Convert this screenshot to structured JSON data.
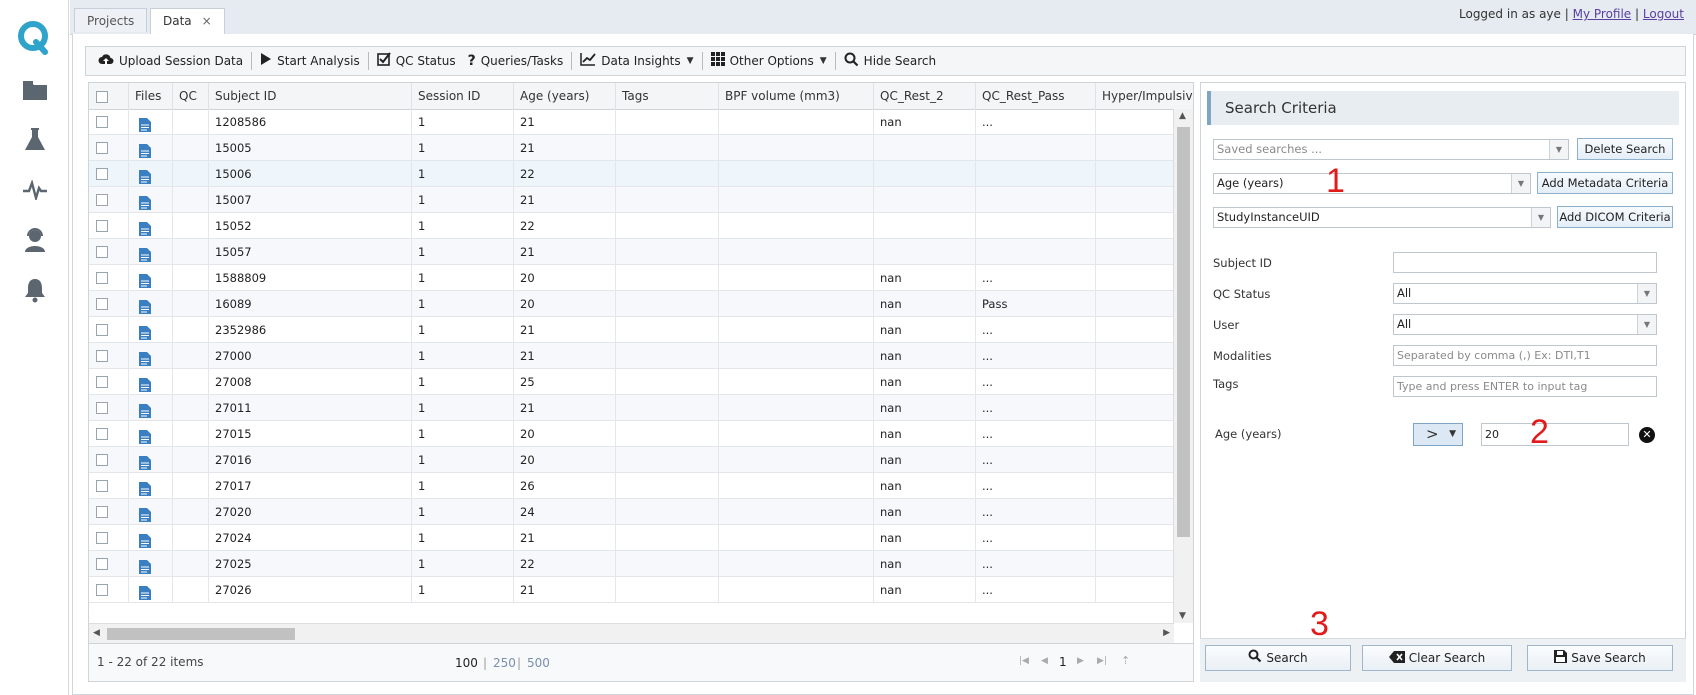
{
  "tabs": [
    {
      "label": "Projects"
    },
    {
      "label": "Data",
      "close": "×"
    }
  ],
  "user": {
    "logged_in_text": "Logged in as",
    "username": "aye",
    "sep": "|",
    "profile_link": "My Profile",
    "logout_link": "Logout"
  },
  "toolbar": {
    "upload": "Upload Session Data",
    "start": "Start Analysis",
    "qc": "QC Status",
    "queries": "Queries/Tasks",
    "insights": "Data Insights",
    "other": "Other Options",
    "hide": "Hide Search"
  },
  "grid": {
    "headers": [
      "Files",
      "QC",
      "Subject ID",
      "Session ID",
      "Age (years)",
      "Tags",
      "BPF volume (mm3)",
      "QC_Rest_2",
      "QC_Rest_Pass",
      "Hyper/Impulsiv"
    ],
    "rows": [
      {
        "subject": "1208586",
        "session": "1",
        "age": "21",
        "qc_rest_2": "nan",
        "qc_rest_pass": "..."
      },
      {
        "subject": "15005",
        "session": "1",
        "age": "21",
        "qc_rest_2": "",
        "qc_rest_pass": ""
      },
      {
        "subject": "15006",
        "session": "1",
        "age": "22",
        "qc_rest_2": "",
        "qc_rest_pass": ""
      },
      {
        "subject": "15007",
        "session": "1",
        "age": "21",
        "qc_rest_2": "",
        "qc_rest_pass": ""
      },
      {
        "subject": "15052",
        "session": "1",
        "age": "22",
        "qc_rest_2": "",
        "qc_rest_pass": ""
      },
      {
        "subject": "15057",
        "session": "1",
        "age": "21",
        "qc_rest_2": "",
        "qc_rest_pass": ""
      },
      {
        "subject": "1588809",
        "session": "1",
        "age": "20",
        "qc_rest_2": "nan",
        "qc_rest_pass": "..."
      },
      {
        "subject": "16089",
        "session": "1",
        "age": "20",
        "qc_rest_2": "nan",
        "qc_rest_pass": "Pass"
      },
      {
        "subject": "2352986",
        "session": "1",
        "age": "21",
        "qc_rest_2": "nan",
        "qc_rest_pass": "..."
      },
      {
        "subject": "27000",
        "session": "1",
        "age": "21",
        "qc_rest_2": "nan",
        "qc_rest_pass": "..."
      },
      {
        "subject": "27008",
        "session": "1",
        "age": "25",
        "qc_rest_2": "nan",
        "qc_rest_pass": "..."
      },
      {
        "subject": "27011",
        "session": "1",
        "age": "21",
        "qc_rest_2": "nan",
        "qc_rest_pass": "..."
      },
      {
        "subject": "27015",
        "session": "1",
        "age": "20",
        "qc_rest_2": "nan",
        "qc_rest_pass": "..."
      },
      {
        "subject": "27016",
        "session": "1",
        "age": "20",
        "qc_rest_2": "nan",
        "qc_rest_pass": "..."
      },
      {
        "subject": "27017",
        "session": "1",
        "age": "26",
        "qc_rest_2": "nan",
        "qc_rest_pass": "..."
      },
      {
        "subject": "27020",
        "session": "1",
        "age": "24",
        "qc_rest_2": "nan",
        "qc_rest_pass": "..."
      },
      {
        "subject": "27024",
        "session": "1",
        "age": "21",
        "qc_rest_2": "nan",
        "qc_rest_pass": "..."
      },
      {
        "subject": "27025",
        "session": "1",
        "age": "22",
        "qc_rest_2": "nan",
        "qc_rest_pass": "..."
      },
      {
        "subject": "27026",
        "session": "1",
        "age": "21",
        "qc_rest_2": "nan",
        "qc_rest_pass": "..."
      }
    ]
  },
  "pager": {
    "summary": "1 - 22 of 22 items",
    "sizes": [
      "100",
      "250",
      "500"
    ],
    "sep": "|",
    "page": "1"
  },
  "search": {
    "title": "Search Criteria",
    "saved_placeholder": "Saved searches ...",
    "delete_btn": "Delete Search",
    "metadata_select": "Age (years)",
    "add_metadata_btn": "Add Metadata Criteria",
    "dicom_select": "StudyInstanceUID",
    "add_dicom_btn": "Add DICOM Criteria",
    "subject_label": "Subject ID",
    "qc_label": "QC Status",
    "qc_value": "All",
    "user_label": "User",
    "user_value": "All",
    "modalities_label": "Modalities",
    "modalities_placeholder": "Separated by comma (,) Ex: DTI,T1",
    "tags_label": "Tags",
    "tags_placeholder": "Type and press ENTER to input tag",
    "age_label": "Age (years)",
    "age_operator": ">",
    "age_value": "20",
    "search_btn": "Search",
    "clear_btn": "Clear Search",
    "save_btn": "Save Search"
  },
  "annotations": [
    "1",
    "2",
    "3"
  ],
  "colors": {
    "accent": "#2fa3c9",
    "annotation": "#e11b1b",
    "icon_blue": "#3a7fc1"
  }
}
